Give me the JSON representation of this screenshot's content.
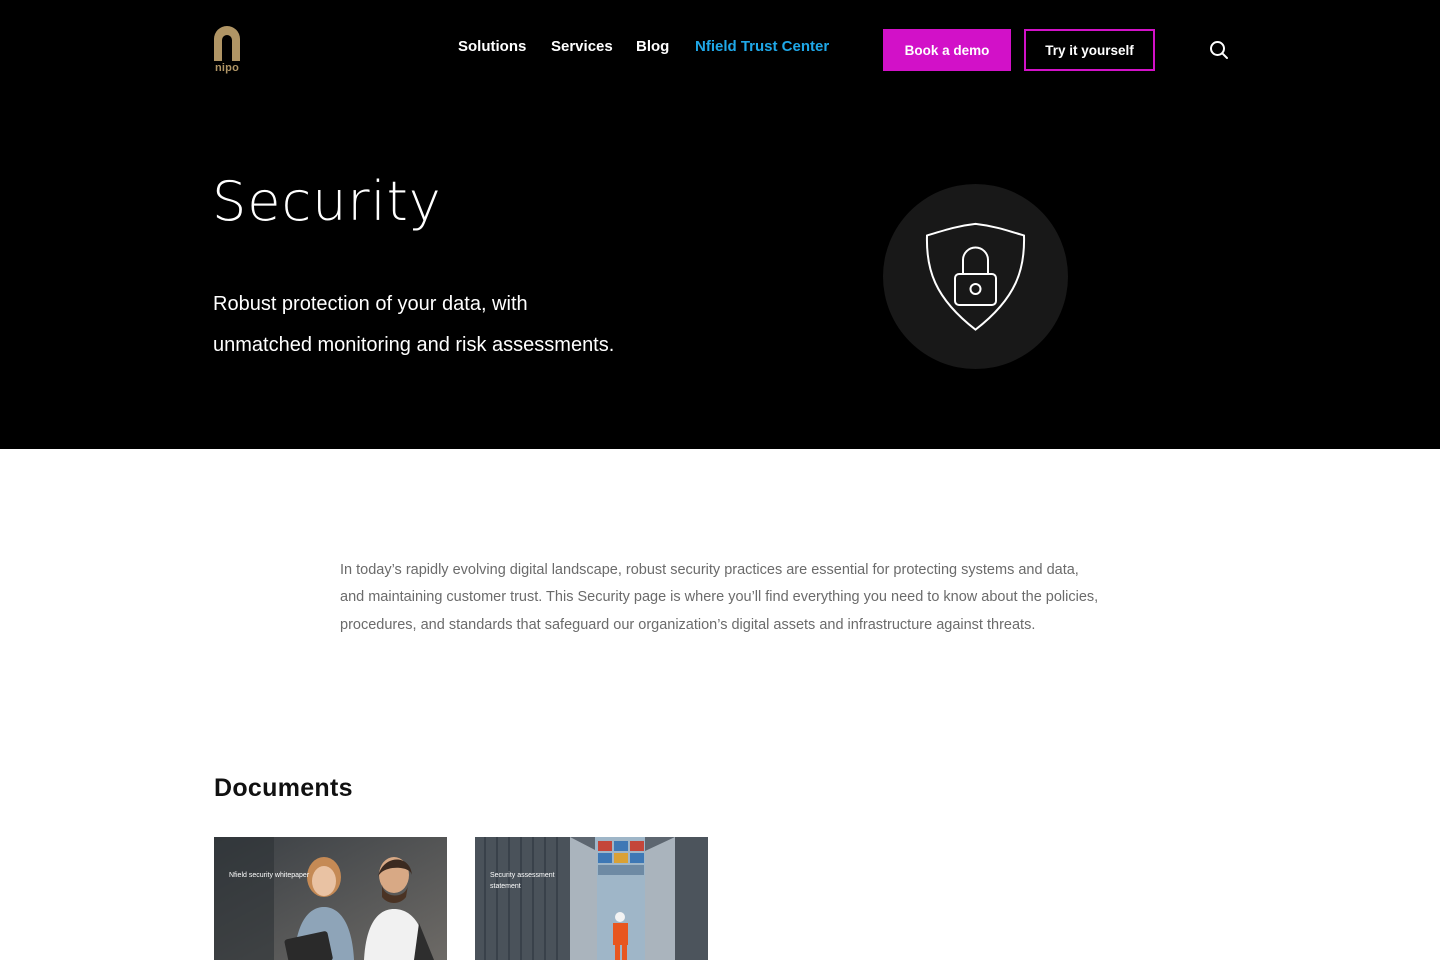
{
  "brand": {
    "logo_text": "nipo",
    "logo_color": "#b09565"
  },
  "nav": {
    "items": [
      {
        "label": "Solutions"
      },
      {
        "label": "Services"
      },
      {
        "label": "Blog"
      },
      {
        "label": "Nfield Trust Center",
        "active": true
      }
    ],
    "book_demo_label": "Book a demo",
    "try_label": "Try it yourself",
    "search_icon": "search-icon"
  },
  "hero": {
    "title": "Security",
    "subtitle_line1": "Robust protection of your data, with",
    "subtitle_line2": "unmatched monitoring and risk assessments.",
    "icon": "shield-lock-icon"
  },
  "intro": {
    "text": "In today’s rapidly evolving digital landscape, robust security practices are essential for protecting systems and data, and maintaining customer trust. This Security page is where you’ll find everything you need to know about the policies, procedures, and standards that safeguard our organization’s digital assets and infrastructure against threats."
  },
  "documents": {
    "heading": "Documents",
    "cards": [
      {
        "title": "Nfield security whitepaper"
      },
      {
        "title": "Security assessment statement"
      }
    ]
  },
  "colors": {
    "accent": "#d211c8",
    "active_link": "#1fa8e8",
    "hero_bg": "#000000"
  }
}
